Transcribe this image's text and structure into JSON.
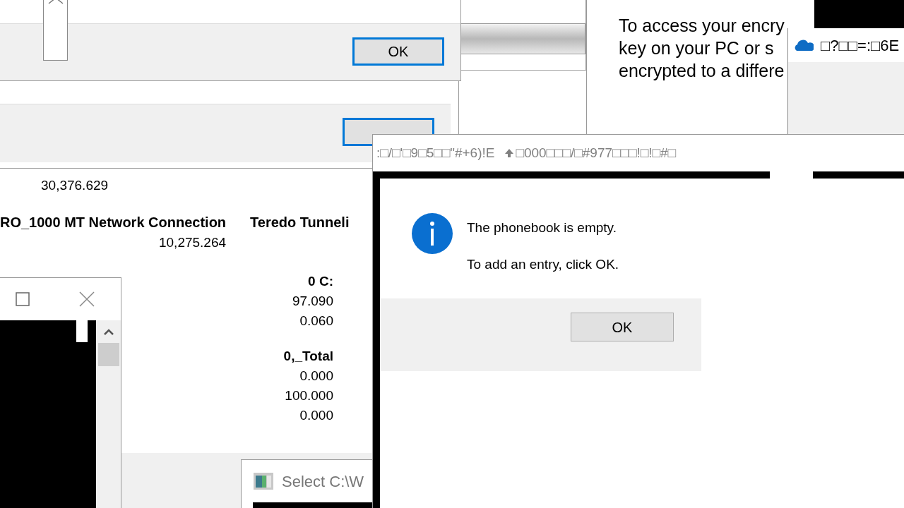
{
  "first_dialog": {
    "ok_button": {
      "label": "OK",
      "focused": true
    }
  },
  "second_dialog": {
    "ok_button": {
      "focused": true
    }
  },
  "encryption_notice": {
    "lines": [
      "To access your encry",
      "key on your PC or s",
      "encrypted to a differe"
    ]
  },
  "onedrive_window": {
    "title": "□?□□=:□6E"
  },
  "performance_window": {
    "top_value": "30,376.629",
    "columns": [
      {
        "header": "RO_1000 MT Network Connection",
        "values": [
          "10,275.264"
        ]
      },
      {
        "header": "Teredo Tunneli"
      }
    ],
    "groups": [
      {
        "header": "0 C:",
        "values": [
          "97.090",
          "0.060"
        ]
      },
      {
        "header": "0,_Total",
        "values": [
          "0.000",
          "100.000",
          "0.000"
        ]
      }
    ]
  },
  "select_window": {
    "title": "Select C:\\W"
  },
  "phonebook_dialog": {
    "title_part_1": ":□/□'□9□5□□\"#+6)!E",
    "title_part_2": "□000□□□/□#977□□□!□!□#□",
    "message": [
      "The phonebook is empty.",
      "To add an entry, click OK."
    ],
    "ok_button": {
      "label": "OK",
      "focused": false
    }
  }
}
